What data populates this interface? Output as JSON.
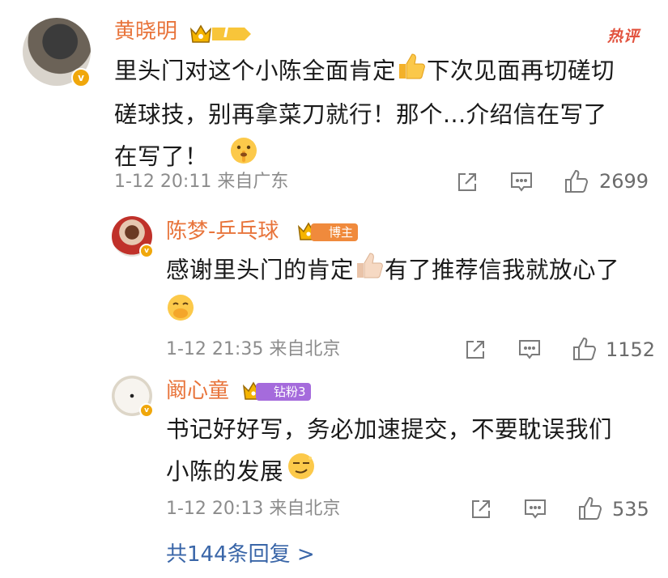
{
  "main_comment": {
    "author": "黄晓明",
    "level": "I",
    "hot_label": "热评",
    "text_1": "里头门对这个小陈全面肯定",
    "text_2": "下次见面再切磋切",
    "text_3": "磋球技，别再拿菜刀就行！那个...介绍信在写了",
    "text_4": "在写了！",
    "time_location": "1-12 20:11 来自广东",
    "likes": "2699",
    "icons": [
      "share-icon",
      "comment-icon",
      "like-icon"
    ]
  },
  "replies": [
    {
      "author": "陈梦-乒乓球",
      "tag": "博主",
      "tag_color": "#f08a3c",
      "text_1": "感谢里头门的肯定",
      "text_2": "有了推荐信我就放心了",
      "time_location": "1-12 21:35 来自北京",
      "likes": "1152"
    },
    {
      "author": "阚心童",
      "tag": "钻粉3",
      "tag_color": "#a56bdc",
      "text_1": "书记好好写，务必加速提交，不要耽误我们",
      "text_2": "小陈的发展",
      "time_location": "1-12 20:13 来自北京",
      "likes": "535"
    }
  ],
  "more_replies": "共144条回复 >"
}
